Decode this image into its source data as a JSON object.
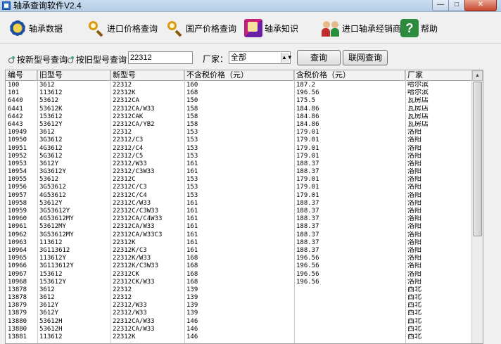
{
  "window": {
    "title": "轴承查询软件V2.4",
    "min_glyph": "—",
    "max_glyph": "□",
    "close_glyph": "✕"
  },
  "toolbar": [
    {
      "label": "轴承数据",
      "icon": "gear-icon"
    },
    {
      "label": "进口价格查询",
      "icon": "magnifier-icon"
    },
    {
      "label": "国产价格查询",
      "icon": "magnifier-icon"
    },
    {
      "label": "轴承知识",
      "icon": "book-icon"
    },
    {
      "label": "进口轴承经销商",
      "icon": "people-icon"
    },
    {
      "label": "帮助",
      "icon": "help-book-icon"
    }
  ],
  "search": {
    "radio_new": "按新型号查询",
    "radio_old": "按旧型号查询",
    "model_value": "22312",
    "factory_label": "厂家：",
    "factory_selected": "全部",
    "query_button": "查询",
    "online_query_button": "联网查询"
  },
  "table": {
    "columns": [
      "编号",
      "旧型号",
      "新型号",
      "不含税价格（元）",
      "含税价格（元）",
      "厂家"
    ],
    "rows": [
      [
        "100",
        "3612",
        "22312",
        "160",
        "187.2",
        "哈尔滨"
      ],
      [
        "101",
        "113612",
        "22312K",
        "168",
        "196.56",
        "哈尔滨"
      ],
      [
        "6440",
        "53612",
        "22312CA",
        "150",
        "175.5",
        "瓦房店"
      ],
      [
        "6441",
        "53612K",
        "22312CA/W33",
        "158",
        "184.86",
        "瓦房店"
      ],
      [
        "6442",
        "153612",
        "22312CAK",
        "158",
        "184.86",
        "瓦房店"
      ],
      [
        "6443",
        "53612Y",
        "22312CA/YB2",
        "158",
        "184.86",
        "瓦房店"
      ],
      [
        "10949",
        "3612",
        "22312",
        "153",
        "179.01",
        "洛阳"
      ],
      [
        "10950",
        "3G3612",
        "22312/C3",
        "153",
        "179.01",
        "洛阳"
      ],
      [
        "10951",
        "4G3612",
        "22312/C4",
        "153",
        "179.01",
        "洛阳"
      ],
      [
        "10952",
        "5G3612",
        "22312/C5",
        "153",
        "179.01",
        "洛阳"
      ],
      [
        "10953",
        "3612Y",
        "22312/W33",
        "161",
        "188.37",
        "洛阳"
      ],
      [
        "10954",
        "3G3612Y",
        "22312/C3W33",
        "161",
        "188.37",
        "洛阳"
      ],
      [
        "10955",
        "53612",
        "22312C",
        "153",
        "179.01",
        "洛阳"
      ],
      [
        "10956",
        "3G53612",
        "22312C/C3",
        "153",
        "179.01",
        "洛阳"
      ],
      [
        "10957",
        "4G53612",
        "22312C/C4",
        "153",
        "179.01",
        "洛阳"
      ],
      [
        "10958",
        "53612Y",
        "22312C/W33",
        "161",
        "188.37",
        "洛阳"
      ],
      [
        "10959",
        "3G53612Y",
        "22312C/C3W33",
        "161",
        "188.37",
        "洛阳"
      ],
      [
        "10960",
        "4G53612MY",
        "22312CA/C4W33",
        "161",
        "188.37",
        "洛阳"
      ],
      [
        "10961",
        "53612MY",
        "22312CA/W33",
        "161",
        "188.37",
        "洛阳"
      ],
      [
        "10962",
        "3G53612MY",
        "22312CA/W33C3",
        "161",
        "188.37",
        "洛阳"
      ],
      [
        "10963",
        "113612",
        "22312K",
        "161",
        "188.37",
        "洛阳"
      ],
      [
        "10964",
        "3G113612",
        "22312K/C3",
        "161",
        "188.37",
        "洛阳"
      ],
      [
        "10965",
        "113612Y",
        "22312K/W33",
        "168",
        "196.56",
        "洛阳"
      ],
      [
        "10966",
        "3G113612Y",
        "22312K/C3W33",
        "168",
        "196.56",
        "洛阳"
      ],
      [
        "10967",
        "153612",
        "22312CK",
        "168",
        "196.56",
        "洛阳"
      ],
      [
        "10968",
        "153612Y",
        "22312CK/W33",
        "168",
        "196.56",
        "洛阳"
      ],
      [
        "13878",
        "3612",
        "22312",
        "139",
        "",
        "西北"
      ],
      [
        "13878",
        "3612",
        "22312",
        "139",
        "",
        "西北"
      ],
      [
        "13879",
        "3612Y",
        "22312/W33",
        "139",
        "",
        "西北"
      ],
      [
        "13879",
        "3612Y",
        "22312/W33",
        "139",
        "",
        "西北"
      ],
      [
        "13880",
        "53612H",
        "22312CA/W33",
        "146",
        "",
        "西北"
      ],
      [
        "13880",
        "53612H",
        "22312CA/W33",
        "146",
        "",
        "西北"
      ],
      [
        "13881",
        "113612",
        "22312K",
        "146",
        "",
        "西北"
      ]
    ]
  },
  "scrollbar": {
    "up": "▲",
    "down": "▼"
  }
}
